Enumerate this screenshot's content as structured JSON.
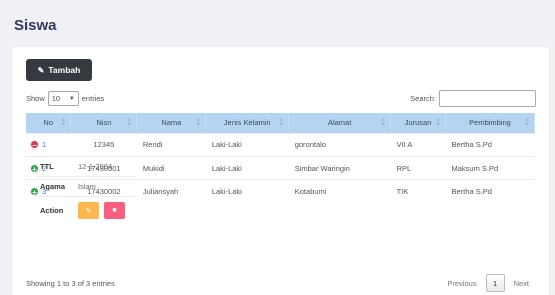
{
  "page": {
    "title": "Siswa"
  },
  "toolbar": {
    "add_label": "Tambah",
    "add_icon": "edit-icon"
  },
  "length": {
    "show": "Show",
    "value": "10",
    "entries": "entries"
  },
  "search": {
    "label": "Search:"
  },
  "table": {
    "headers": [
      "No",
      "Nisn",
      "Nama",
      "Jenis Kelamin",
      "Alamat",
      "Jurusan",
      "Pembimbing"
    ],
    "rows": [
      {
        "no": "1",
        "nisn": "12345",
        "nama": "Rendi",
        "jk": "Laki-Laki",
        "alamat": "gorontalo",
        "jurusan": "VII A",
        "pembimbing": "Bertha S.Pd",
        "expanded": true
      },
      {
        "no": "2",
        "nisn": "17430001",
        "nama": "Mukidi",
        "jk": "Laki-Laki",
        "alamat": "Simbar Waringin",
        "jurusan": "RPL",
        "pembimbing": "Maksum S.Pd",
        "expanded": false
      },
      {
        "no": "3",
        "nisn": "17430002",
        "nama": "Juliansyah",
        "jk": "Laki-Laki",
        "alamat": "Kotabumi",
        "jurusan": "TIK",
        "pembimbing": "Bertha S.Pd",
        "expanded": false
      }
    ]
  },
  "detail": {
    "ttl_label": "TTL",
    "ttl_value": "12-1-2004",
    "agama_label": "Agama",
    "agama_value": "Islam",
    "action_label": "Action"
  },
  "footer": {
    "info": "Showing 1 to 3 of 3 entries",
    "previous": "Previous",
    "page": "1",
    "next": "Next"
  },
  "colors": {
    "header_bg": "#b5d4f1",
    "edit": "#ffb64d",
    "delete": "#fc5e7f",
    "expand_open": "#dc3545",
    "expand_closed": "#28a745"
  }
}
